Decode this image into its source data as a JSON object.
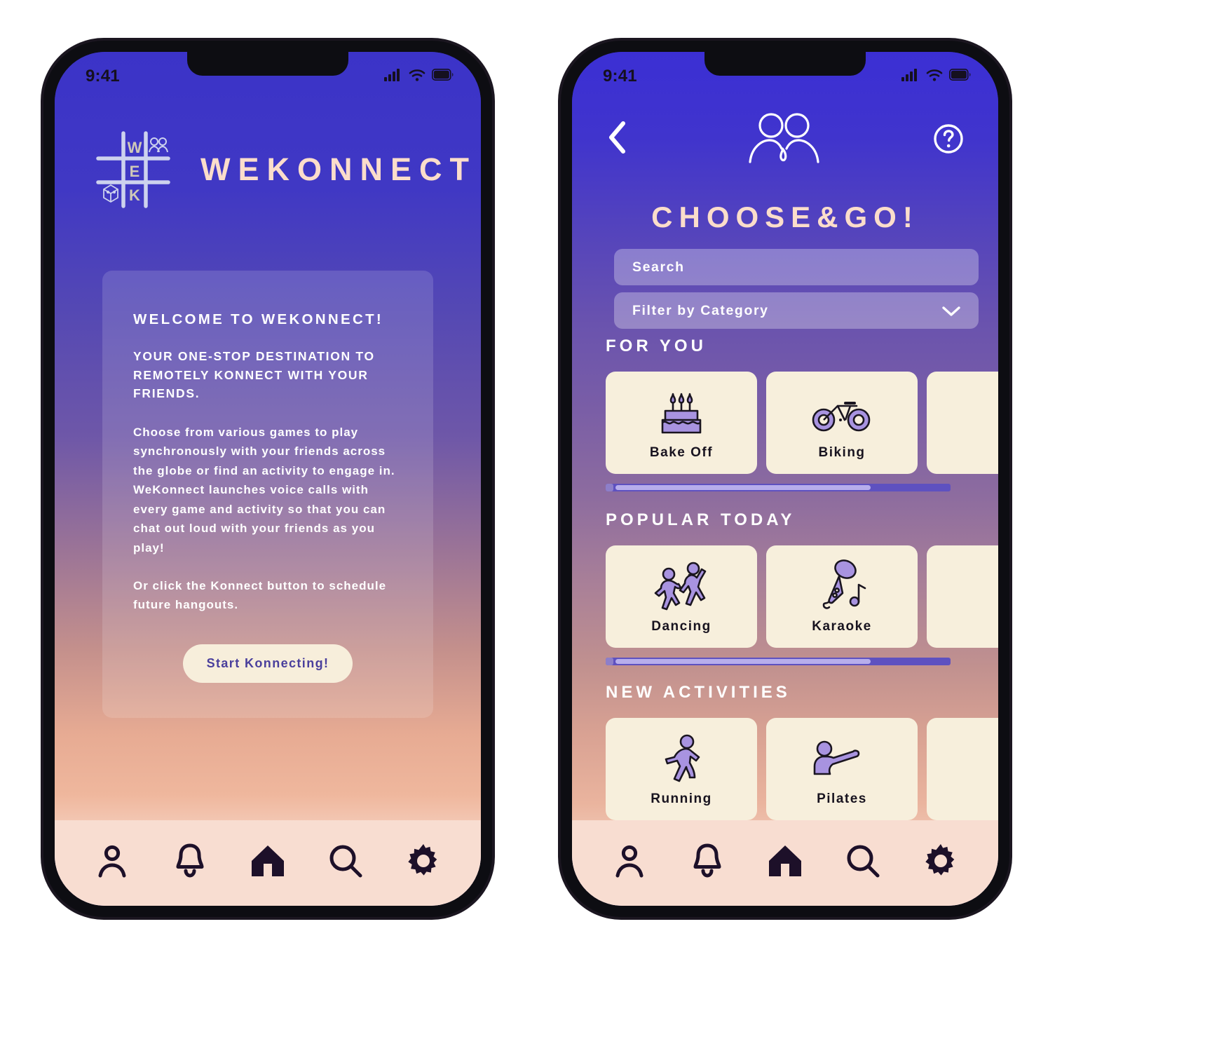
{
  "brand": {
    "name": "WEKONNECT",
    "logo_icon": "tictactoe-grid-logo",
    "logo_letters": [
      "W",
      "E",
      "K"
    ],
    "accent_cream": "#fbddcb",
    "accent_card_cream": "#f7efdc",
    "brand_blue": "#3b33c8",
    "brand_purple": "#5448b4",
    "icon_purple": "#a893e0",
    "nav_dark": "#1d1029"
  },
  "screen1": {
    "status": {
      "time": "9:41",
      "signal_icon": "cellular-signal-icon",
      "wifi_icon": "wifi-icon",
      "battery_icon": "battery-full-icon"
    },
    "welcome": {
      "title": "WELCOME TO WEKONNECT!",
      "subtitle": "YOUR ONE-STOP DESTINATION TO REMOTELY KONNECT WITH YOUR FRIENDS.",
      "paragraph1": "Choose from various games to play synchronously with your friends across the globe or find an activity to engage in. WeKonnect launches voice calls with every game and activity so that you can chat out loud with your friends as you play!",
      "paragraph2": "Or click the Konnect button to schedule future hangouts.",
      "cta_label": "Start Konnecting!"
    }
  },
  "screen2": {
    "status": {
      "time": "9:41",
      "signal_icon": "cellular-signal-icon",
      "wifi_icon": "wifi-icon",
      "battery_icon": "battery-full-icon"
    },
    "topbar": {
      "back_icon": "chevron-left-icon",
      "friends_icon": "two-people-icon",
      "help_icon": "help-circle-icon"
    },
    "title": "CHOOSE&GO!",
    "search": {
      "placeholder": "Search",
      "value": ""
    },
    "filter": {
      "label": "Filter by Category",
      "chevron_icon": "chevron-down-icon"
    },
    "sections": [
      {
        "heading": "FOR YOU",
        "cards": [
          {
            "label": "Bake Off",
            "icon": "birthday-cake-icon"
          },
          {
            "label": "Biking",
            "icon": "bicycle-icon"
          },
          {
            "label": "",
            "icon": ""
          }
        ],
        "scrollbar": {
          "thumb_percent": 74
        }
      },
      {
        "heading": "POPULAR TODAY",
        "cards": [
          {
            "label": "Dancing",
            "icon": "dancing-couple-icon"
          },
          {
            "label": "Karaoke",
            "icon": "microphone-music-icon"
          },
          {
            "label": "",
            "icon": ""
          }
        ],
        "scrollbar": {
          "thumb_percent": 74
        }
      },
      {
        "heading": "NEW ACTIVITIES",
        "cards": [
          {
            "label": "Running",
            "icon": "running-person-icon"
          },
          {
            "label": "Pilates",
            "icon": "pilates-stretch-icon"
          },
          {
            "label": "",
            "icon": ""
          }
        ],
        "scrollbar": {
          "thumb_percent": 74
        }
      }
    ]
  },
  "bottom_nav": {
    "items": [
      {
        "name": "profile",
        "icon": "person-icon"
      },
      {
        "name": "notifications",
        "icon": "bell-icon"
      },
      {
        "name": "home",
        "icon": "home-icon"
      },
      {
        "name": "search",
        "icon": "search-icon"
      },
      {
        "name": "settings",
        "icon": "gear-icon"
      }
    ]
  }
}
